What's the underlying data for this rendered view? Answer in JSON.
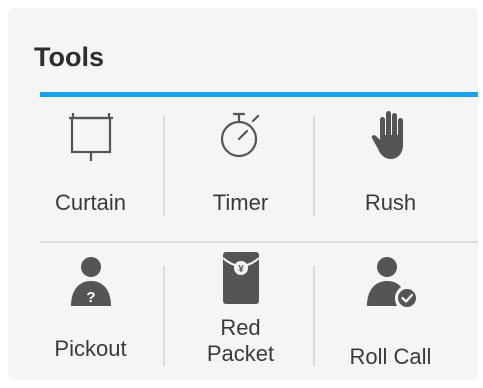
{
  "panel": {
    "title": "Tools"
  },
  "tools": [
    {
      "label": "Curtain",
      "icon": "curtain-icon"
    },
    {
      "label": "Timer",
      "icon": "stopwatch-icon"
    },
    {
      "label": "Rush",
      "icon": "hand-icon"
    },
    {
      "label": "Pickout",
      "icon": "user-question-icon"
    },
    {
      "label_line1": "Red",
      "label_line2": "Packet",
      "icon": "red-packet-icon"
    },
    {
      "label": "Roll Call",
      "icon": "user-check-icon"
    }
  ],
  "colors": {
    "accent": "#17a2e8",
    "icon": "#555555",
    "text": "#3a3a3a",
    "divider": "#dcdcdc"
  }
}
